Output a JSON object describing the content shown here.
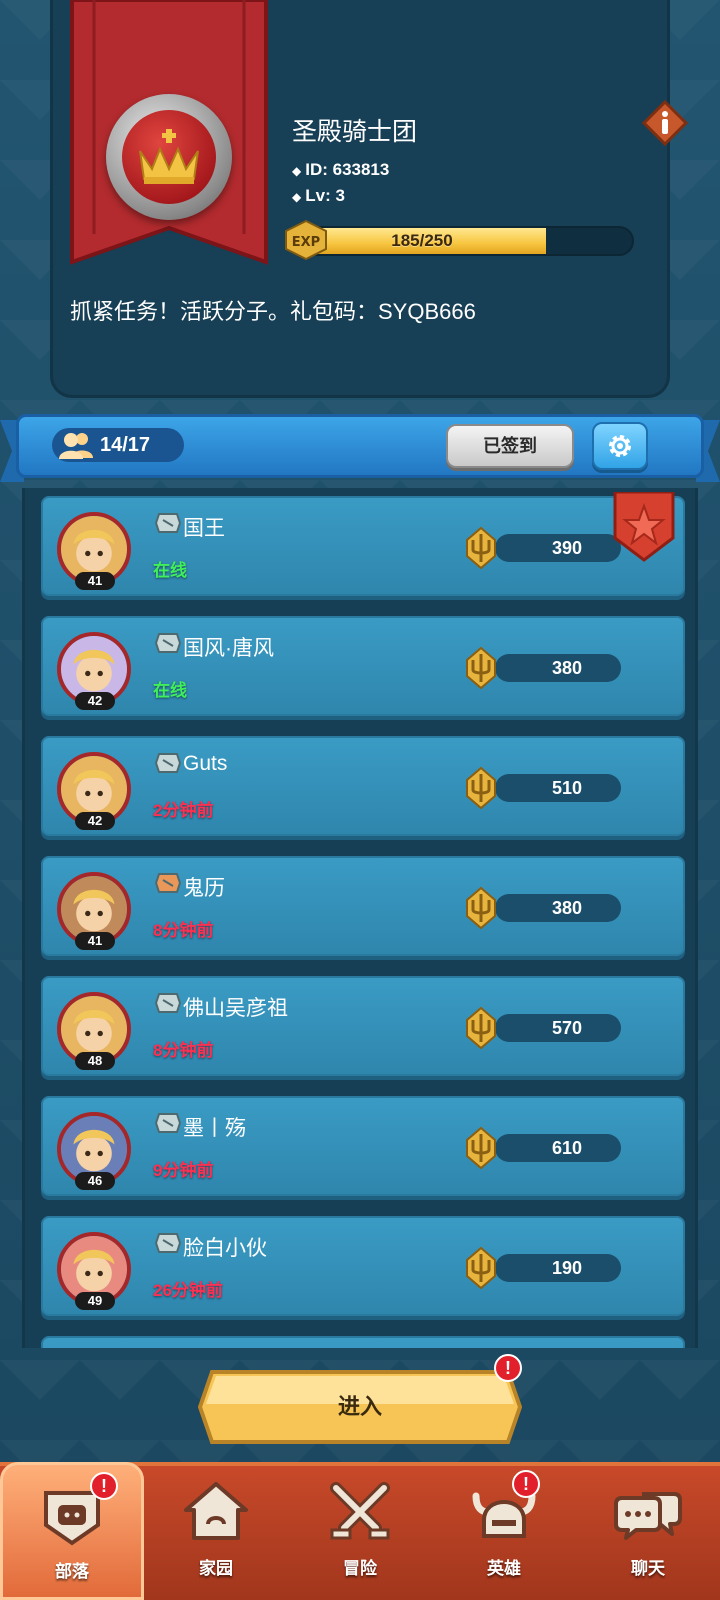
{
  "guild": {
    "name": "圣殿骑士团",
    "id_text": "ID:  633813",
    "level_text": "Lv: 3",
    "exp": "185/250",
    "exp_fraction": 0.74,
    "exp_badge": "EXP",
    "description": "抓紧任务！活跃分子。礼包码：SYQB666"
  },
  "members_header": {
    "count": "14/17",
    "signed_label": "已签到"
  },
  "members": [
    {
      "name": "国王",
      "level": "41",
      "status": "在线",
      "score": "390"
    },
    {
      "name": "国风·唐风",
      "level": "42",
      "status": "在线",
      "score": "380"
    },
    {
      "name": "Guts",
      "level": "42",
      "status": "2分钟前",
      "score": "510"
    },
    {
      "name": "鬼历",
      "level": "41",
      "status": "8分钟前",
      "score": "380"
    },
    {
      "name": "佛山吴彦祖",
      "level": "48",
      "status": "8分钟前",
      "score": "570"
    },
    {
      "name": "墨丨殇",
      "level": "46",
      "status": "9分钟前",
      "score": "610"
    },
    {
      "name": "脸白小伙",
      "level": "49",
      "status": "26分钟前",
      "score": "190"
    }
  ],
  "enter_button": {
    "label": "进入",
    "alert": "!"
  },
  "nav": [
    {
      "label": "部落",
      "icon": "tribe-icon",
      "alert": "!"
    },
    {
      "label": "家园",
      "icon": "home-icon"
    },
    {
      "label": "冒险",
      "icon": "crossed-swords-icon"
    },
    {
      "label": "英雄",
      "icon": "viking-helmet-icon",
      "alert": "!"
    },
    {
      "label": "聊天",
      "icon": "chat-bubbles-icon"
    }
  ],
  "colors": {
    "online": "#3ff05a",
    "offline": "#ff2f52",
    "nav_bg": "#c8492a",
    "accent_blue": "#2f86ad"
  }
}
